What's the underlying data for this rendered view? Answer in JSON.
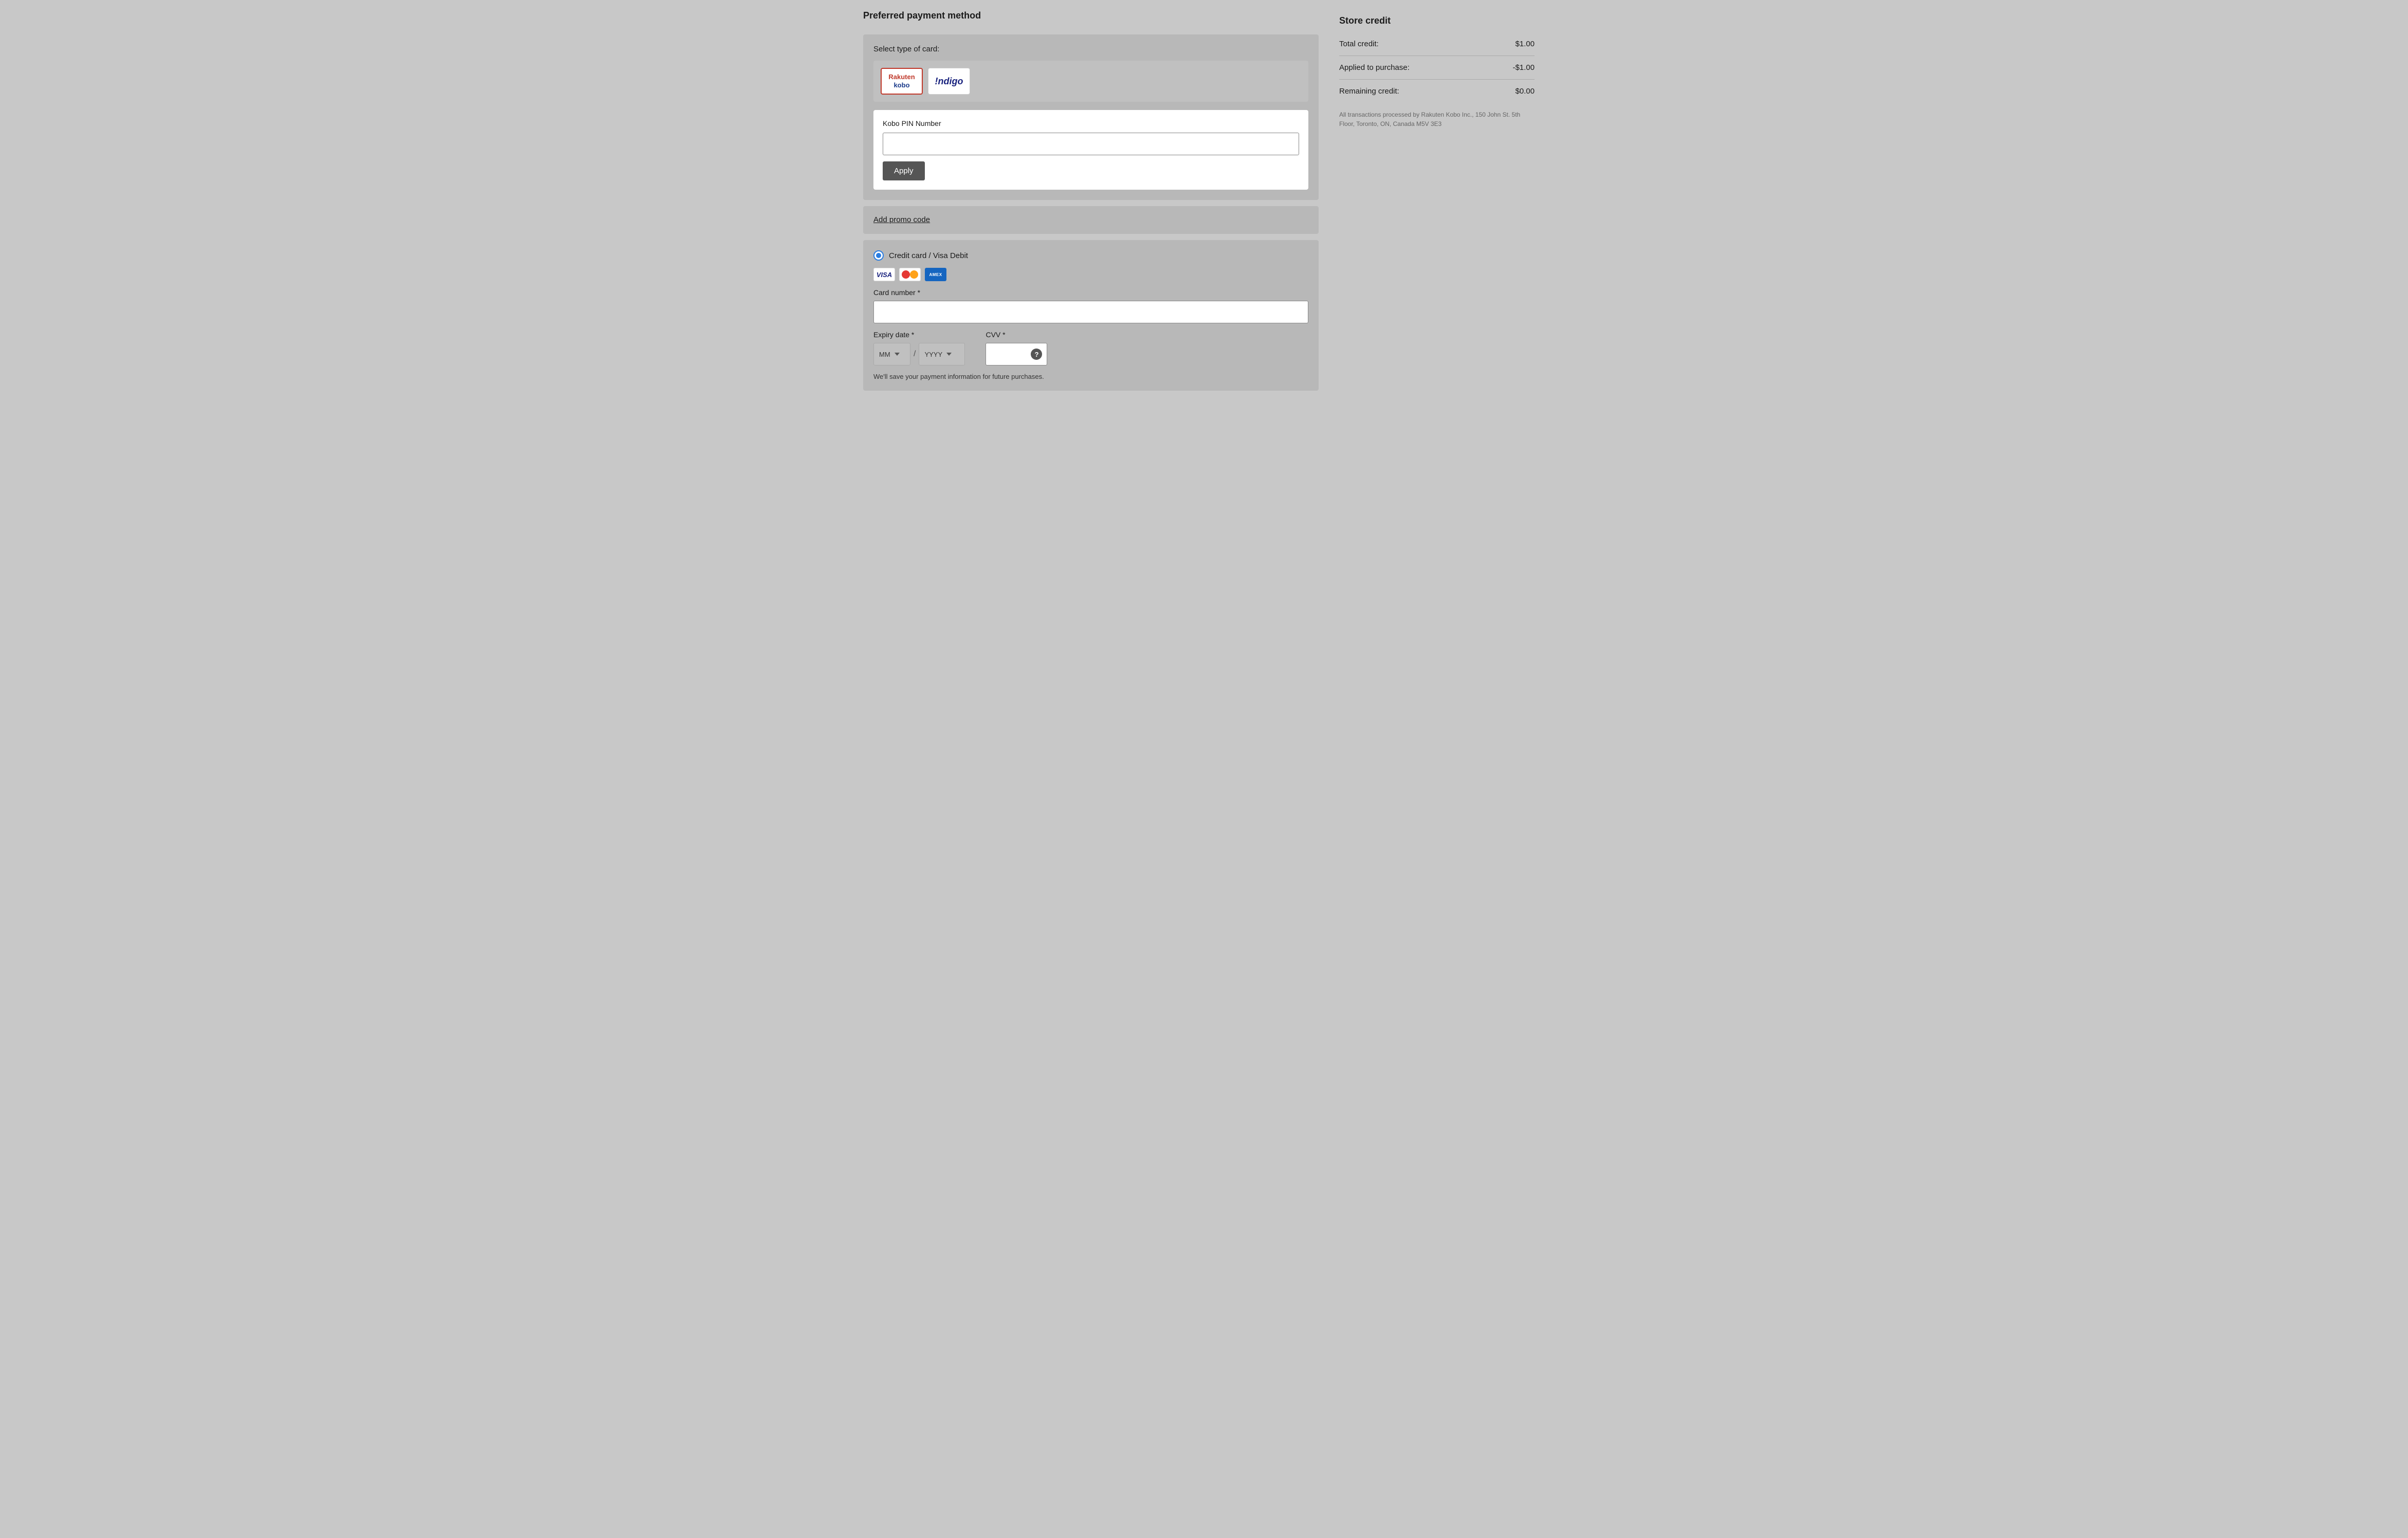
{
  "page": {
    "left_title": "Preferred payment method",
    "card_type_label": "Select type of card:",
    "cards": [
      {
        "id": "rakuten-kobo",
        "label_line1": "Rakuten",
        "label_line2": "kobo",
        "selected": true
      },
      {
        "id": "indigo",
        "label": "Indigo",
        "selected": false
      }
    ],
    "pin_section": {
      "label": "Kobo PIN Number",
      "placeholder": "",
      "apply_button": "Apply"
    },
    "promo_section": {
      "link_text": "Add promo code"
    },
    "credit_card_section": {
      "radio_label": "Credit card / Visa Debit",
      "card_logos": [
        "VISA",
        "MC",
        "AMEX"
      ],
      "card_number_label": "Card number *",
      "card_number_placeholder": "",
      "expiry_label": "Expiry date *",
      "expiry_month_default": "MM",
      "expiry_year_default": "YYYY",
      "cvv_label": "CVV *",
      "cvv_placeholder": "",
      "save_info_text": "We'll save your payment information for future purchases."
    },
    "right_column": {
      "title": "Store credit",
      "rows": [
        {
          "label": "Total credit:",
          "value": "$1.00"
        },
        {
          "label": "Applied to purchase:",
          "value": "-$1.00"
        },
        {
          "label": "Remaining credit:",
          "value": "$0.00"
        }
      ],
      "transaction_note": "All transactions processed by Rakuten Kobo Inc., 150 John St. 5th Floor, Toronto, ON, Canada M5V 3E3"
    }
  }
}
